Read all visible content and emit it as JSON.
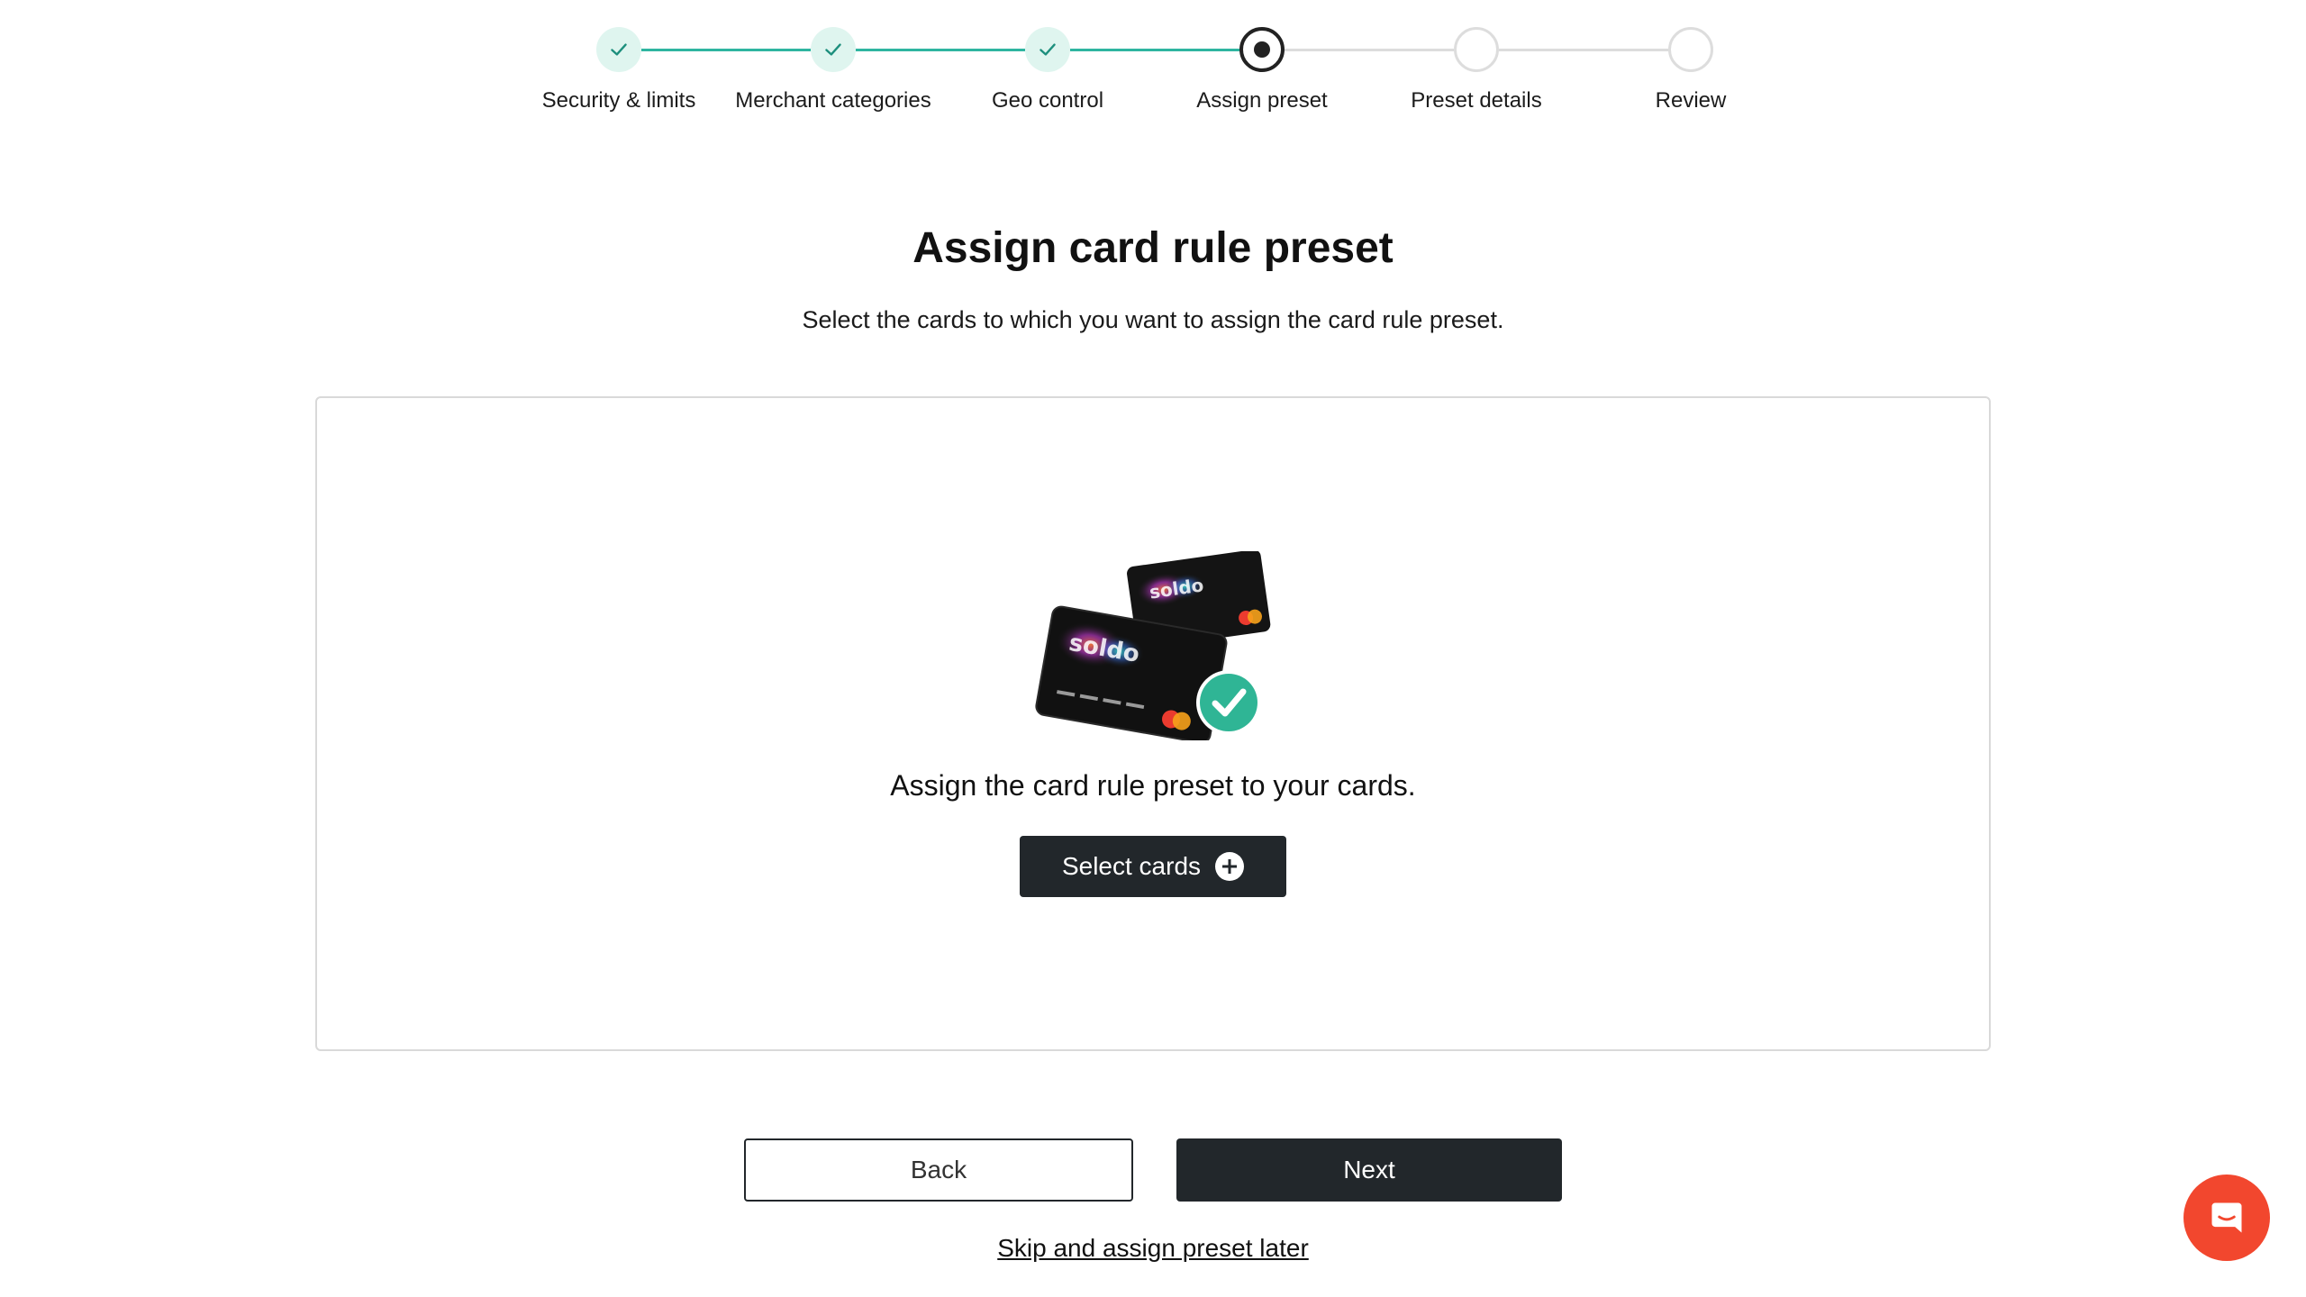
{
  "stepper": {
    "steps": [
      {
        "label": "Security & limits",
        "state": "done"
      },
      {
        "label": "Merchant categories",
        "state": "done"
      },
      {
        "label": "Geo control",
        "state": "done"
      },
      {
        "label": "Assign preset",
        "state": "active"
      },
      {
        "label": "Preset details",
        "state": "pending"
      },
      {
        "label": "Review",
        "state": "pending"
      }
    ]
  },
  "header": {
    "title": "Assign card rule preset",
    "subtitle": "Select the cards to which you want to assign the card rule preset."
  },
  "panel": {
    "illustration_icon": "cards-check-icon",
    "card_brand_text": "soldo",
    "message": "Assign the card rule preset to your cards.",
    "select_button_label": "Select cards",
    "select_button_icon": "plus-circle-icon"
  },
  "actions": {
    "back_label": "Back",
    "next_label": "Next",
    "skip_label": "Skip and assign preset later"
  },
  "chat": {
    "icon": "chat-icon"
  },
  "colors": {
    "accent_green": "#2fb5a0",
    "done_circle_bg": "#dff5ef",
    "dark_button": "#22272b",
    "chat_button": "#f2472e",
    "panel_border": "#d9d9d9"
  }
}
